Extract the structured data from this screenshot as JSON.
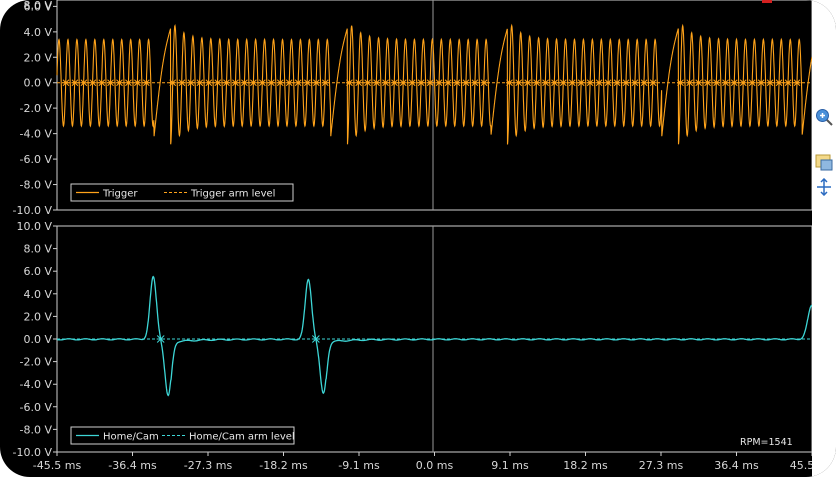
{
  "chart_data": {
    "type": "line",
    "x_unit_ticks": [
      "-45.5 ms",
      "-36.4 ms",
      "-27.3 ms",
      "-18.2 ms",
      "-9.1 ms",
      "0.0 ms",
      "9.1 ms",
      "18.2 ms",
      "27.3 ms",
      "36.4 ms",
      "45.5 ms"
    ],
    "xlim": [
      -45.5,
      45.5
    ],
    "panels": [
      {
        "id": "trigger",
        "ylim": [
          -10,
          6.5
        ],
        "y_ticks": [
          "6.0 V",
          "4.0 V",
          "2.0 V",
          "0.0 V",
          "-2.0 V",
          "-4.0 V",
          "-6.0 V",
          "-8.0 V",
          "-10.0 V"
        ],
        "y_tick_values": [
          6,
          4,
          2,
          0,
          -2,
          -4,
          -6,
          -8,
          -10
        ],
        "top_label": "8.0 V",
        "legend": [
          "Trigger",
          "Trigger arm level"
        ],
        "series_color": "#ffa31a",
        "waveform": "Crank trigger sine-like signal, ~3.5 V amplitude rising to ~6 V after each missing-tooth gap",
        "missing_tooth_gaps_ms": [
          -32.6,
          -11.3,
          8.0,
          28.6,
          45.5
        ],
        "arm_level_v": 0.0
      },
      {
        "id": "homecam",
        "ylim": [
          -10,
          10
        ],
        "y_ticks": [
          "10.0 V",
          "8.0 V",
          "6.0 V",
          "4.0 V",
          "2.0 V",
          "0.0 V",
          "-2.0 V",
          "-4.0 V",
          "-6.0 V",
          "-8.0 V",
          "-10.0 V"
        ],
        "y_tick_values": [
          10,
          8,
          6,
          4,
          2,
          0,
          -2,
          -4,
          -6,
          -8,
          -10
        ],
        "legend": [
          "Home/Cam",
          "Home/Cam arm level"
        ],
        "series_color": "#3dd6d6",
        "pulses": [
          {
            "t_ms": -33.0,
            "peak_v": 5.5,
            "trough_v": -5.0
          },
          {
            "t_ms": -14.3,
            "peak_v": 5.3,
            "trough_v": -4.8
          }
        ],
        "end_rise": {
          "t_ms": 45.5,
          "v": 3.0
        },
        "arm_level_v": 0.0
      }
    ],
    "annotation": "RPM=1541",
    "grid": "center crosshair"
  },
  "icons": [
    "zoom-icon",
    "image-export-icon",
    "vertical-split-icon"
  ]
}
